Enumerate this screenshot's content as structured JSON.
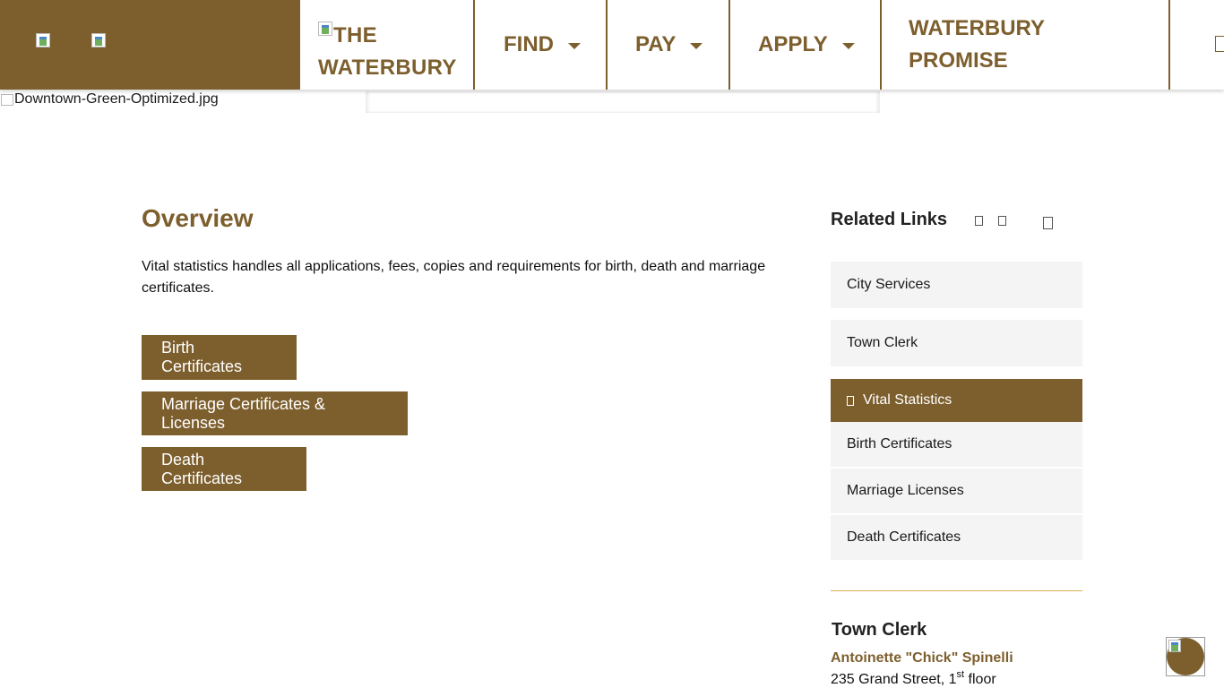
{
  "header": {
    "logo_alt_line1": "THE",
    "logo_alt_line2": "WATERBURY",
    "nav": {
      "find": "FIND",
      "pay": "PAY",
      "apply": "APPLY",
      "promise_line1": "WATERBURY",
      "promise_line2": "PROMISE"
    }
  },
  "hero": {
    "broken_image_alt": "Downtown-Green-Optimized.jpg"
  },
  "main": {
    "title": "Overview",
    "description": "Vital statistics handles all applications, fees, copies and requirements for birth, death and marriage certificates.",
    "buttons": {
      "birth": "Birth Certificates",
      "marriage": "Marriage Certificates & Licenses",
      "death": "Death Certificates"
    }
  },
  "sidebar": {
    "title": "Related Links",
    "links": {
      "city_services": "City Services",
      "town_clerk": "Town Clerk",
      "vital_statistics": "Vital Statistics",
      "birth": "Birth Certificates",
      "marriage": "Marriage Licenses",
      "death": "Death Certificates"
    },
    "contact": {
      "heading": "Town Clerk",
      "name": "Antoinette \"Chick\" Spinelli",
      "address_prefix": "235 Grand Street, 1",
      "address_sup": "st",
      "address_suffix": " floor"
    }
  },
  "colors": {
    "brand": "#7d5f2e",
    "sidebar_bg": "#f4f4f4",
    "divider": "#d8b04a"
  },
  "icons": {
    "header_left_1": "broken-image-icon",
    "header_left_2": "broken-image-icon",
    "nav_caret": "caret-down-icon",
    "sidebar_toggle": "square-icon",
    "floating_button": "accessibility-icon"
  }
}
